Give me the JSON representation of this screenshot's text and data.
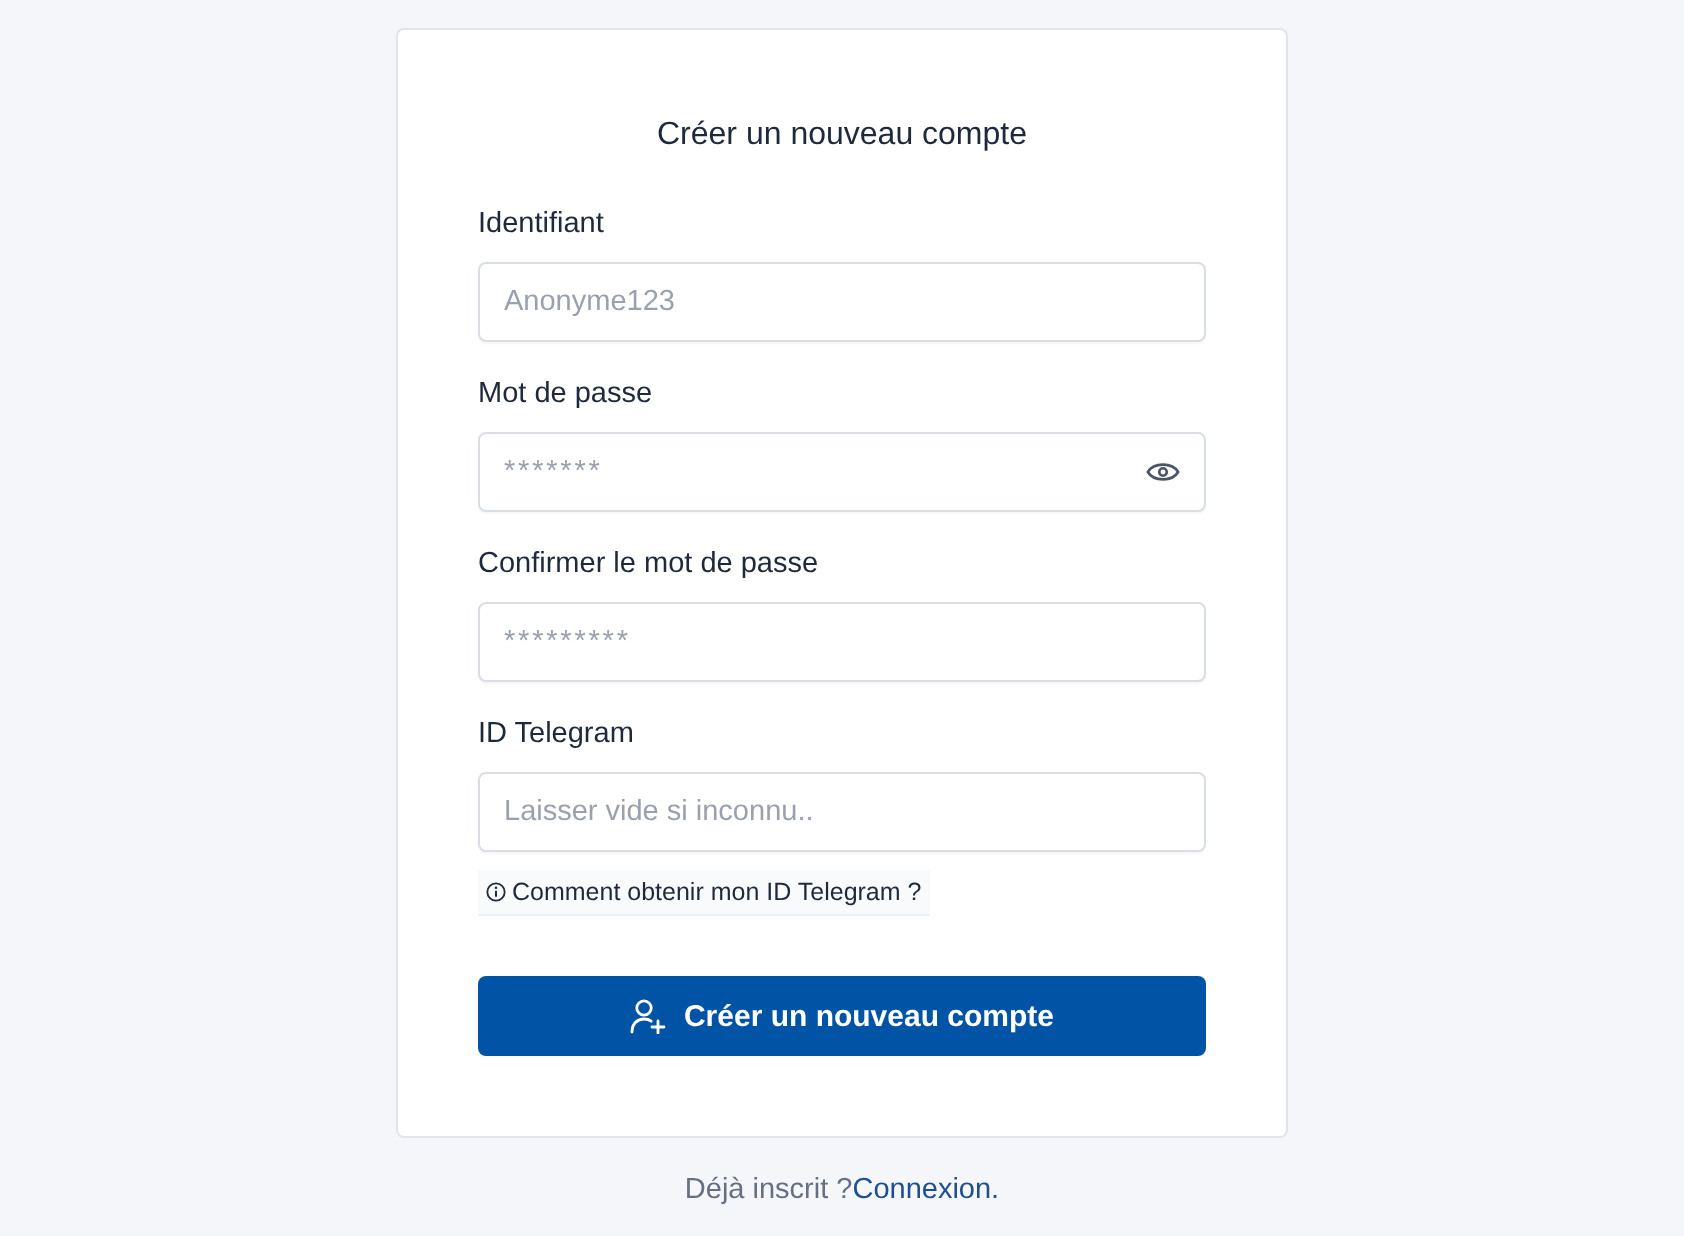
{
  "card": {
    "title": "Créer un nouveau compte"
  },
  "fields": [
    {
      "kind": "text",
      "label": "Identifiant",
      "placeholder": "Anonyme123",
      "reveal_toggle": false
    },
    {
      "kind": "password",
      "label": "Mot de passe",
      "placeholder": "*******",
      "reveal_toggle": true
    },
    {
      "kind": "password",
      "label": "Confirmer le mot de passe",
      "placeholder": "*********",
      "reveal_toggle": false
    },
    {
      "kind": "text",
      "label": "ID Telegram",
      "placeholder": "Laisser vide si inconnu..",
      "reveal_toggle": false,
      "help_link": "Comment obtenir mon ID Telegram ?"
    }
  ],
  "submit_button": {
    "label": "Créer un nouveau compte"
  },
  "footer": {
    "prompt": "Déjà inscrit ?",
    "link": "Connexion."
  }
}
